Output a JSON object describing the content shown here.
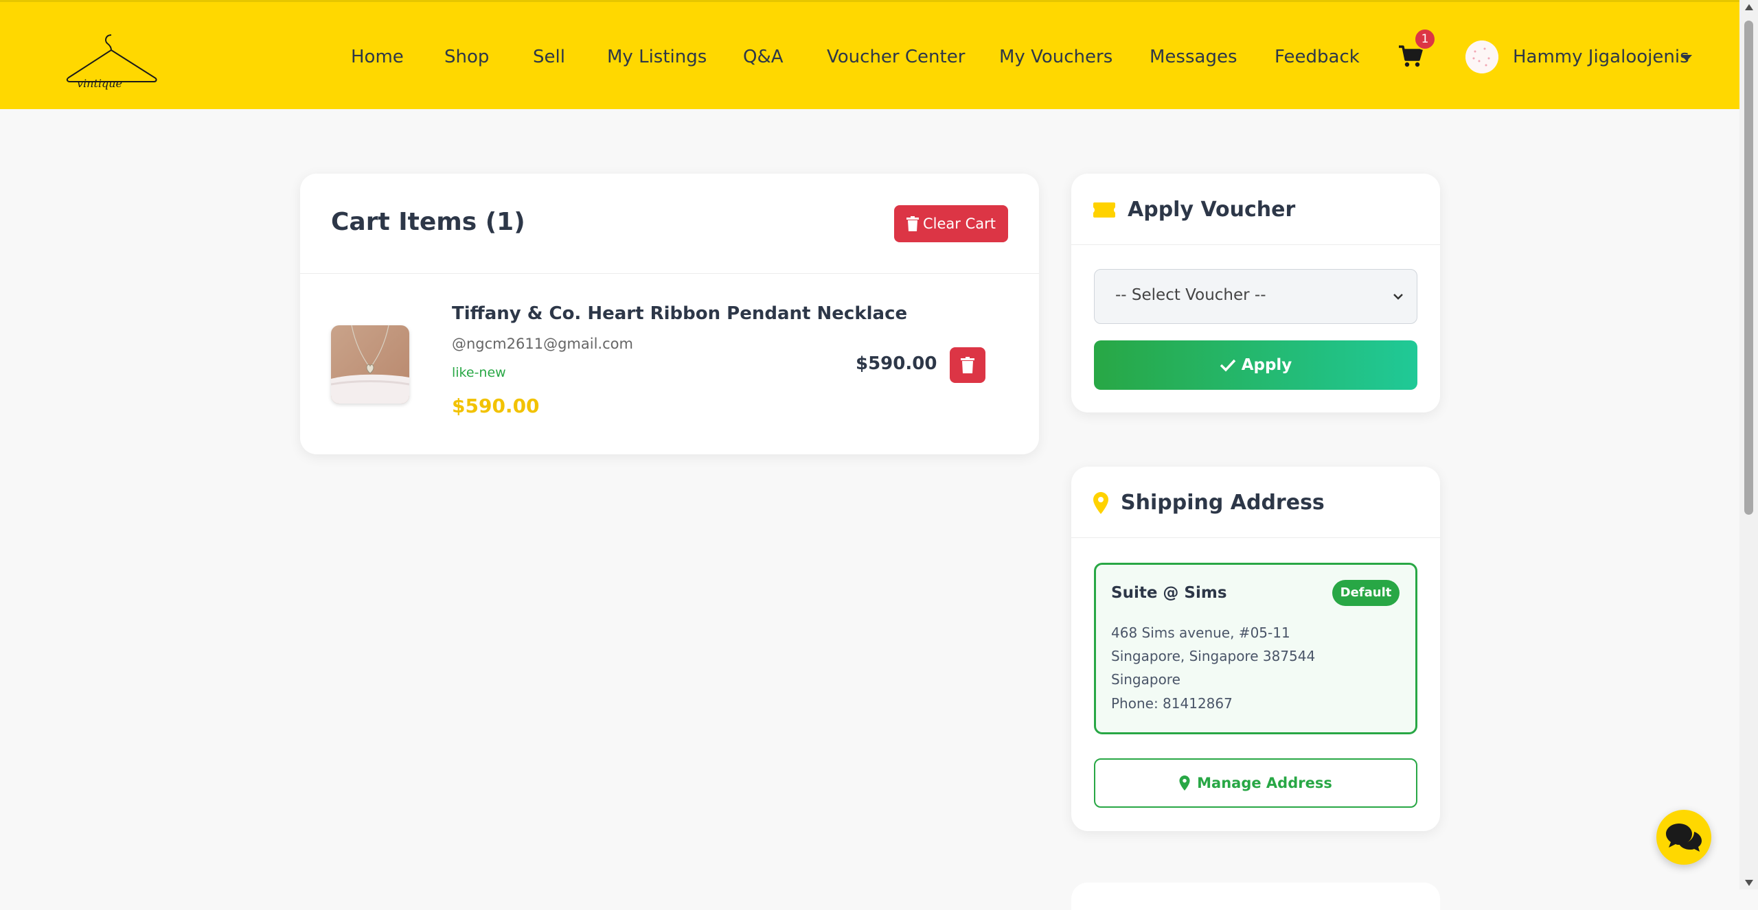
{
  "nav": {
    "logo_text": "vintique",
    "links": [
      "Home",
      "Shop",
      "Sell",
      "My Listings",
      "Q&A",
      "Voucher Center",
      "My Vouchers",
      "Messages",
      "Feedback"
    ],
    "cart_count": "1",
    "user_name": "Hammy Jigaloojenis"
  },
  "cart": {
    "title": "Cart Items (1)",
    "clear_label": "Clear Cart",
    "item": {
      "name": "Tiffany & Co. Heart Ribbon Pendant Necklace",
      "seller": "@ngcm2611@gmail.com",
      "condition": "like-new",
      "price": "$590.00",
      "total": "$590.00"
    }
  },
  "voucher": {
    "title": "Apply Voucher",
    "select_selected": "-- Select Voucher --",
    "apply_label": "Apply"
  },
  "shipping": {
    "title": "Shipping Address",
    "address": {
      "name": "Suite @ Sims",
      "badge": "Default",
      "line1": "468 Sims avenue, #05-11",
      "line2": "Singapore, Singapore 387544",
      "line3": "Singapore",
      "phone": "Phone: 81412867"
    },
    "manage_label": "Manage Address"
  },
  "colors": {
    "navbar": "#ffd800",
    "danger": "#dc3545",
    "success": "#28a745",
    "price": "#f2c200"
  }
}
